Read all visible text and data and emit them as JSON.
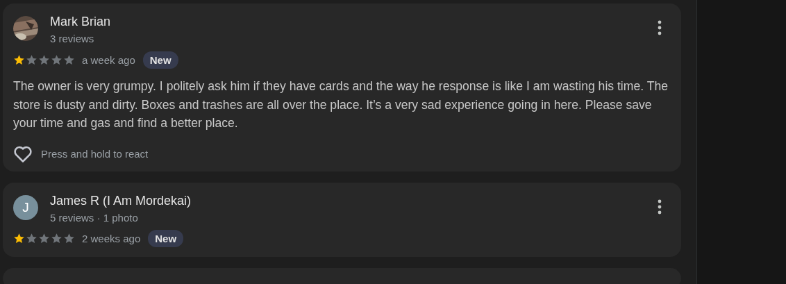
{
  "reviews": [
    {
      "name": "Mark Brian",
      "meta": "3 reviews",
      "stars": 1,
      "time": "a week ago",
      "badge": "New",
      "text": "The owner is very grumpy. I politely ask him if they have cards and the way he response is like I am wasting his time. The store is dusty and dirty. Boxes and trashes are all over the place. It’s a very sad experience going in here. Please save your time and gas and find a better place.",
      "react": "Press and hold to react"
    },
    {
      "avatar": {
        "kind": "letter",
        "letter": "J",
        "color": "#78909c"
      },
      "name": "James R (I Am Mordekai)",
      "meta": "5 reviews · 1 photo",
      "stars": 1,
      "time": "2 weeks ago",
      "badge": "New"
    }
  ]
}
